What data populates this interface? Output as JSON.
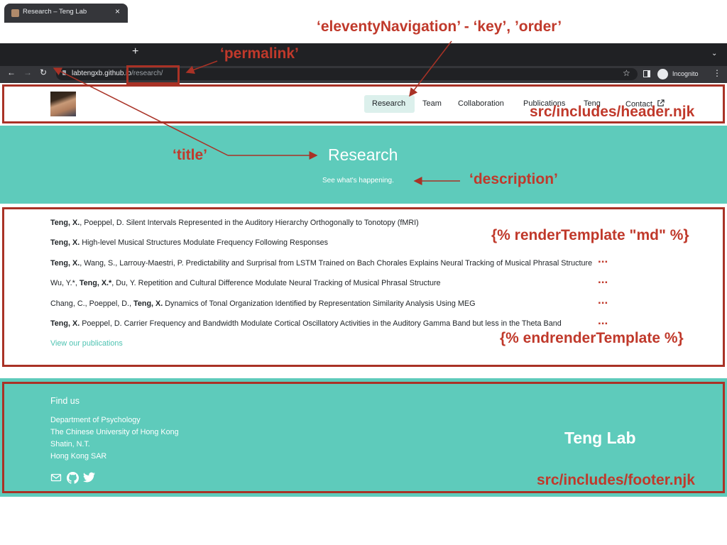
{
  "browser": {
    "tab_title": "Research – Teng Lab",
    "tab_close": "×",
    "new_tab": "+",
    "tab_menu": "⌄",
    "back": "←",
    "forward": "→",
    "reload": "↻",
    "url_host": "labtengxb.github.io",
    "url_path": "/research/",
    "incognito_label": "Incognito",
    "menu": "⋮",
    "star": "☆"
  },
  "header": {
    "nav": [
      "Research",
      "Team",
      "Collaboration",
      "Publications",
      "Teng",
      "Contact"
    ],
    "active_nav": "Research",
    "contact_icon": "external-link-icon"
  },
  "hero": {
    "title": "Research",
    "description": "See what's happening."
  },
  "publications": [
    {
      "authors_bold": "Teng, X.",
      "authors_rest": ", Poeppel, D.",
      "title": "Silent Intervals Represented in the Auditory Hierarchy Orthogonally to Tonotopy (fMRI)"
    },
    {
      "authors_bold": "Teng, X.",
      "authors_rest": "",
      "title": "High-level Musical Structures Modulate Frequency Following Responses"
    },
    {
      "authors_bold": "Teng, X.",
      "authors_rest": ", Wang, S., Larrouy-Maestri, P.",
      "title": "Predictability and Surprisal from LSTM Trained on Bach Chorales Explains Neural Tracking of Musical Phrasal Structure"
    },
    {
      "authors_pre": "Wu, Y.*, ",
      "authors_bold": "Teng, X.*",
      "authors_rest": ", Du, Y.",
      "title": "Repetition and Cultural Difference Modulate Neural Tracking of Musical Phrasal Structure"
    },
    {
      "authors_pre": "Chang, C., Poeppel, D., ",
      "authors_bold": "Teng, X.",
      "authors_rest": "",
      "title": "Dynamics of Tonal Organization Identified by Representation Similarity Analysis Using MEG"
    },
    {
      "authors_bold": "Teng, X.",
      "authors_rest": " Poeppel, D.",
      "title": "Carrier Frequency and Bandwidth Modulate Cortical Oscillatory Activities in the Auditory Gamma Band but less in the Theta Band"
    }
  ],
  "view_publications": "View our publications",
  "footer": {
    "heading": "Find us",
    "address": [
      "Department of Psychology",
      "The Chinese University of Hong Kong",
      "Shatin, N.T.",
      "Hong Kong SAR"
    ],
    "social_icons": [
      "mail-icon",
      "github-icon",
      "twitter-icon"
    ],
    "brand": "Teng Lab"
  },
  "annotations": {
    "navigation": "‘eleventyNavigation’ - ‘key’, ’order’",
    "permalink": "‘permalink’",
    "header_file": "src/includes/header.njk",
    "title": "‘title’",
    "description": "‘description’",
    "render_template": "{% renderTemplate \"md\" %}",
    "end_render_template": "{% endrenderTemplate %}",
    "ellipsis": "...",
    "footer_file": "src/includes/footer.njk",
    "color": "#c0392b"
  }
}
